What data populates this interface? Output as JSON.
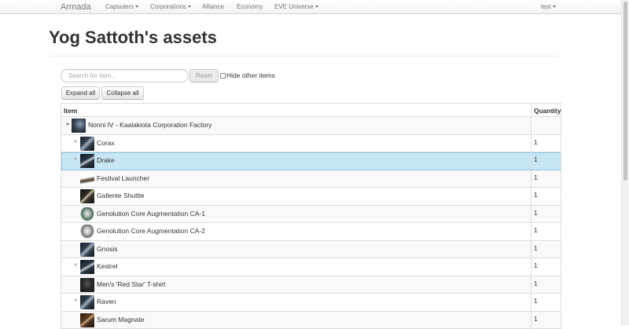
{
  "nav": {
    "brand": "Armada",
    "items": [
      {
        "label": "Capsulers",
        "dropdown": true
      },
      {
        "label": "Corporations",
        "dropdown": true
      },
      {
        "label": "Alliance",
        "dropdown": false
      },
      {
        "label": "Economy",
        "dropdown": false
      },
      {
        "label": "EVE Universe",
        "dropdown": true
      }
    ],
    "user": "test"
  },
  "page": {
    "title": "Yog Sattoth's assets"
  },
  "controls": {
    "search_placeholder": "Search for item...",
    "reset_label": "Reset",
    "hide_label": "Hide other items",
    "expand_label": "Expand all",
    "collapse_label": "Collapse all"
  },
  "table": {
    "headers": {
      "item": "Item",
      "quantity": "Quantity"
    },
    "location": "Nonni IV - Kaalakiota Corporation Factory",
    "rows": [
      {
        "name": "Corax",
        "quantity": "1",
        "expandable": true,
        "icon": "ship-thumbnail"
      },
      {
        "name": "Drake",
        "quantity": "1",
        "expandable": true,
        "selected": true,
        "icon": "ship-thumbnail"
      },
      {
        "name": "Festival Launcher",
        "quantity": "1",
        "expandable": false,
        "icon": "launcher-thumbnail"
      },
      {
        "name": "Gallente Shuttle",
        "quantity": "1",
        "expandable": false,
        "icon": "shuttle-thumbnail"
      },
      {
        "name": "Genolution Core Augmentation CA-1",
        "quantity": "1",
        "expandable": false,
        "icon": "implant-thumbnail"
      },
      {
        "name": "Genolution Core Augmentation CA-2",
        "quantity": "1",
        "expandable": false,
        "icon": "implant-thumbnail"
      },
      {
        "name": "Gnosis",
        "quantity": "1",
        "expandable": false,
        "icon": "ship-thumbnail"
      },
      {
        "name": "Kestrel",
        "quantity": "1",
        "expandable": true,
        "icon": "ship-thumbnail"
      },
      {
        "name": "Men's 'Red Star' T-shirt",
        "quantity": "1",
        "expandable": false,
        "icon": "shirt-thumbnail"
      },
      {
        "name": "Raven",
        "quantity": "1",
        "expandable": true,
        "icon": "ship-thumbnail"
      },
      {
        "name": "Sarum Magnate",
        "quantity": "1",
        "expandable": false,
        "icon": "ship-thumbnail"
      }
    ]
  },
  "colors": {
    "selected_row": "#c7e6f4",
    "selected_border": "#8ac8e3"
  }
}
